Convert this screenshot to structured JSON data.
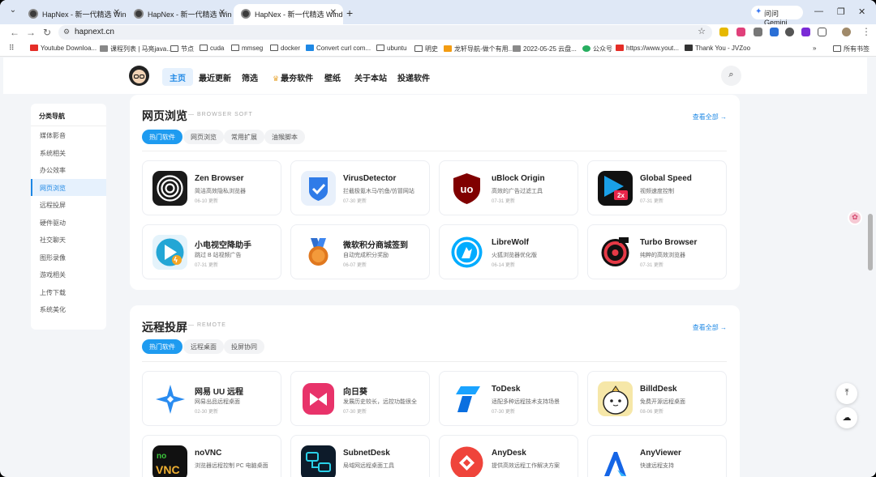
{
  "browser": {
    "tabs": [
      {
        "title": "HapNex - 新一代精选 Window",
        "active": false
      },
      {
        "title": "HapNex - 新一代精选 Window",
        "active": false
      },
      {
        "title": "HapNex - 新一代精选 Window",
        "active": true
      }
    ],
    "gemini_label": "问问 Gemini",
    "url": "hapnext.cn",
    "bookmarks": [
      "Youtube Downloa...",
      "课程列表 | 马亮java...",
      "节点",
      "cuda",
      "mmseg",
      "docker",
      "Convert curl com...",
      "ubuntu",
      "明史",
      "龙轩导航-做个有用...",
      "2022-05-25 云盘...",
      "公众号",
      "https://www.yout...",
      "Thank You - JVZoo"
    ],
    "all_bookmarks": "所有书签"
  },
  "site": {
    "nav": [
      "主页",
      "最近更新",
      "筛选",
      "最夯软件",
      "壁纸",
      "关于本站",
      "投递软件"
    ],
    "active_nav": "主页",
    "sidebar": {
      "title": "分类导航",
      "items": [
        "媒体影音",
        "系统相关",
        "办公效率",
        "网页浏览",
        "远程投屏",
        "硬件驱动",
        "社交聊天",
        "图形录像",
        "游戏相关",
        "上传下载",
        "系统美化"
      ],
      "active": "网页浏览"
    },
    "sections": [
      {
        "title": "网页浏览",
        "subtitle": "BROWSER SOFT",
        "more": "查看全部 →",
        "tabs": [
          "热门软件",
          "网页浏览",
          "常用扩展",
          "油猴脚本"
        ],
        "cards": [
          {
            "name": "Zen Browser",
            "desc": "简洁高效隐私浏览器",
            "date": "06-10 更新"
          },
          {
            "name": "VirusDetector",
            "desc": "拦截极氪木马/钓鱼/仿冒网站",
            "date": "07-30 更新"
          },
          {
            "name": "uBlock Origin",
            "desc": "高效的广告过滤工具",
            "date": "07-31 更新"
          },
          {
            "name": "Global Speed",
            "desc": "视频速度控制",
            "date": "07-31 更新"
          },
          {
            "name": "小电视空降助手",
            "desc": "跳过 B 站视频广告",
            "date": "07-31 更新"
          },
          {
            "name": "微软积分商城签到",
            "desc": "自动完成积分奖励",
            "date": "06-07 更新"
          },
          {
            "name": "LibreWolf",
            "desc": "火狐浏览器优化版",
            "date": "06-14 更新"
          },
          {
            "name": "Turbo Browser",
            "desc": "纯粹的高效浏览器",
            "date": "07-31 更新"
          }
        ]
      },
      {
        "title": "远程投屏",
        "subtitle": "REMOTE",
        "more": "查看全部 →",
        "tabs": [
          "热门软件",
          "远程桌面",
          "投屏协同"
        ],
        "cards": [
          {
            "name": "网易 UU 远程",
            "desc": "网易出品远程桌面",
            "date": "02-30 更新"
          },
          {
            "name": "向日葵",
            "desc": "发展历史较长，远控功能很全",
            "date": "07-30 更新"
          },
          {
            "name": "ToDesk",
            "desc": "适配多种远程技术支持场景",
            "date": "07-30 更新"
          },
          {
            "name": "BilldDesk",
            "desc": "免费开源远程桌面",
            "date": "08-06 更新"
          },
          {
            "name": "noVNC",
            "desc": "浏览器远程控制 PC 电脑桌面",
            "date": ""
          },
          {
            "name": "SubnetDesk",
            "desc": "局域网远程桌面工具",
            "date": ""
          },
          {
            "name": "AnyDesk",
            "desc": "提供高效远程工作解决方案",
            "date": ""
          },
          {
            "name": "AnyViewer",
            "desc": "快速远程支持",
            "date": ""
          }
        ]
      }
    ]
  },
  "colors": {
    "accent": "#1e9bf0",
    "page_bg": "#f3f5f8"
  }
}
